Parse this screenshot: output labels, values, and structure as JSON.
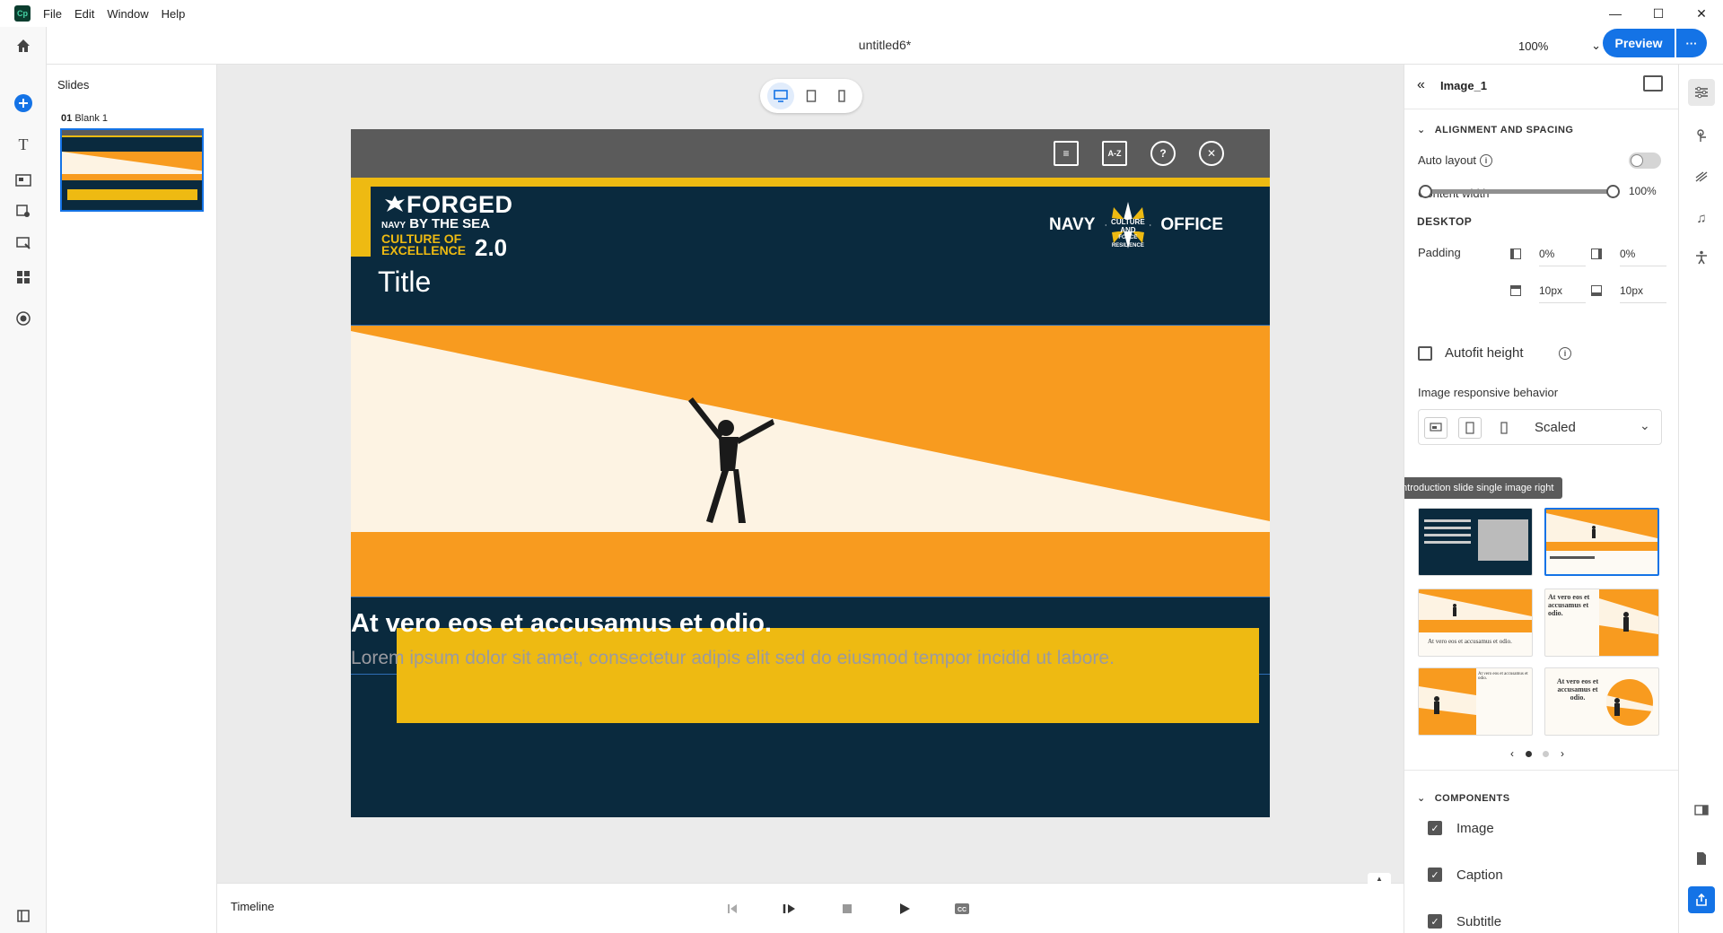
{
  "app": {
    "logo_text": "Cp",
    "menu": [
      "File",
      "Edit",
      "Window",
      "Help"
    ],
    "window_controls": [
      "—",
      "☐",
      "✕"
    ],
    "doc_title": "untitled6*",
    "zoom": "100%",
    "preview_label": "Preview",
    "more_label": "···"
  },
  "slides_panel": {
    "heading": "Slides",
    "slides": [
      {
        "number": "01",
        "name": "Blank 1"
      }
    ]
  },
  "slide": {
    "logo_forged": "FORGED",
    "logo_by_the_sea": "BY THE SEA",
    "logo_navy_small": "NAVY",
    "logo_culture": "CULTURE OF",
    "logo_excellence": "EXCELLENCE",
    "logo_version": "2.0",
    "navy_left": "NAVY",
    "navy_mid_1": "CULTURE AND",
    "navy_mid_2": "FORCE RESILIENCE",
    "navy_right": "OFFICE",
    "title": "Title",
    "heading": "At vero eos et accusamus et odio.",
    "body": "Lorem ipsum dolor sit amet, consectetur adipis elit sed do eiusmod tempor incidid ut labore."
  },
  "timeline": {
    "label": "Timeline"
  },
  "properties": {
    "element_name": "Image_1",
    "section_alignment": "ALIGNMENT AND SPACING",
    "auto_layout_label": "Auto layout",
    "auto_layout_on": false,
    "content_width_label": "Content width",
    "content_width_range": [
      0,
      100
    ],
    "content_width_value": "100%",
    "device_label": "DESKTOP",
    "padding_label": "Padding",
    "padding_left": "0%",
    "padding_right": "0%",
    "padding_top": "10px",
    "padding_bottom": "10px",
    "autofit_label": "Autofit height",
    "autofit_checked": false,
    "responsive_label": "Image responsive behavior",
    "responsive_value": "Scaled",
    "tooltip": "Introduction slide single image right",
    "section_components": "COMPONENTS",
    "components": [
      {
        "label": "Image",
        "checked": true
      },
      {
        "label": "Caption",
        "checked": true
      },
      {
        "label": "Subtitle",
        "checked": true
      }
    ],
    "layout_thumbs": [
      {
        "text": "",
        "active": false
      },
      {
        "text": "",
        "active": true
      },
      {
        "text": "At vero eos et accusamus et odio.",
        "active": false
      },
      {
        "text": "At vero eos et accusamus et odio.",
        "active": false
      },
      {
        "text": "At vero eos et accusamus et odio.",
        "active": false
      },
      {
        "text": "At vero eos et accusamus et odio.",
        "active": false
      }
    ],
    "pager_current": 1,
    "pager_total": 2
  },
  "colors": {
    "accent": "#1473e6",
    "slide_bg": "#0a2a3e",
    "orange": "#f89b1f",
    "yellow": "#eeba12"
  }
}
